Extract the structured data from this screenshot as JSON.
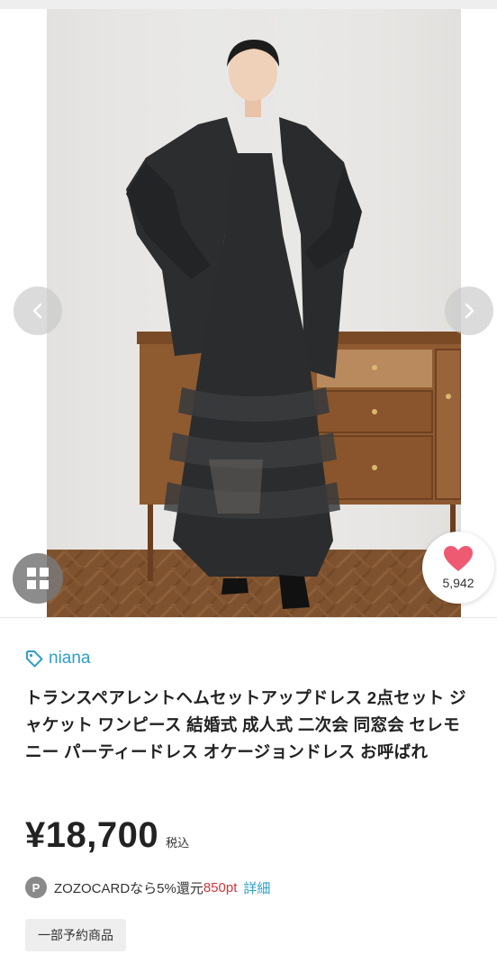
{
  "gallery": {
    "photo_alt": "",
    "prev_icon": "chevron-left-icon",
    "next_icon": "chevron-right-icon",
    "grid_icon": "grid-icon"
  },
  "favorite": {
    "icon": "heart-icon",
    "count": "5,942",
    "heart_color": "#ef5a73"
  },
  "product": {
    "brand": "niana",
    "brand_icon": "tag-icon",
    "brand_color": "#2e9fc9",
    "title": "トランスペアレントヘムセットアップドレス 2点セット ジャケット ワンピース 結婚式 成人式 二次会 同窓会 セレモニー パーティードレス オケージョンドレス お呼ばれ",
    "price": "¥18,700",
    "tax_label": "税込"
  },
  "points": {
    "badge": "P",
    "text": "ZOZOCARDなら5%還元",
    "amount": "850pt",
    "amount_color": "#d4363c",
    "detail_link": "詳細"
  },
  "tags": {
    "preorder": "一部予約商品"
  }
}
